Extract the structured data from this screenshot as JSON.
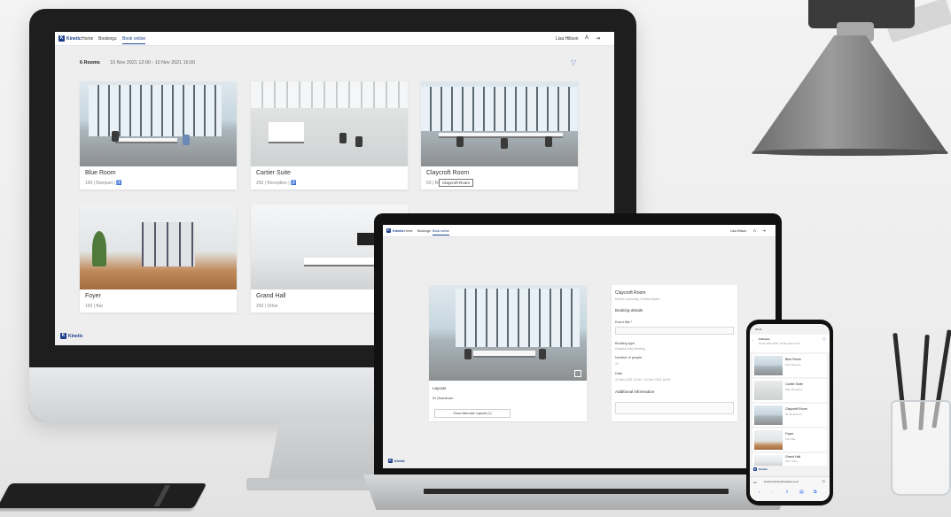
{
  "imac_app": {
    "brand": "Kinetic",
    "nav": {
      "home": "Home",
      "bookings": "Bookings",
      "book_online": "Book online"
    },
    "user": {
      "name": "Lisa Hillson"
    },
    "summary": {
      "count": "6 Rooms",
      "range": "10 Nov 2021 12:00 - 10 Nov 2021 16:00"
    },
    "rooms": [
      {
        "name": "Blue Room",
        "meta": "100 | Banquet | ♿"
      },
      {
        "name": "Cartier Suite",
        "meta": "250 | Reception | ♿"
      },
      {
        "name": "Claycroft Room",
        "meta": "50 | Boardroom"
      },
      {
        "name": "Foyer",
        "meta": "150 | Bar"
      },
      {
        "name": "Grand Hall",
        "meta": "250 | Other"
      }
    ],
    "tooltip": "Claycroft Room",
    "footer_brand": "Kinetic"
  },
  "laptop_app": {
    "brand": "Kinetic",
    "nav": {
      "home": "Home",
      "bookings": "Bookings",
      "book_online": "Book online"
    },
    "user": {
      "name": "Lisa Hillson"
    },
    "layouts": {
      "heading": "Layouts",
      "value": "50 | Boardroom",
      "button": "Show Alternate Layouts (1)"
    },
    "room": {
      "title": "Claycroft Room",
      "subtitle": "Kinetic University, Central Wales"
    },
    "booking": {
      "heading": "Booking details",
      "event_title_label": "Event title *",
      "booking_type_label": "Booking type",
      "booking_type_value": "Campus Day Meeting",
      "people_label": "Number of people",
      "people_value": "10",
      "date_label": "Date",
      "date_value": "10 Nov 2021 12:00 - 10 Nov 2021 16:00",
      "additional": "Additional information"
    },
    "footer_brand": "Kinetic"
  },
  "phone_app": {
    "time": "09:41",
    "header": {
      "count": "6 Rooms",
      "range": "10 Nov 2021 09:00 - 10 Nov 2021 12:00"
    },
    "rooms": [
      {
        "name": "Blue Room",
        "meta": "100 | Banquet"
      },
      {
        "name": "Cartier Suite",
        "meta": "250 | Reception"
      },
      {
        "name": "Claycroft Room",
        "meta": "50 | Boardroom"
      },
      {
        "name": "Foyer",
        "meta": "150 | Bar"
      },
      {
        "name": "Grand Hall",
        "meta": "250 | Other"
      }
    ],
    "footer_brand": "Kinetic",
    "url": "kineticuniversity.kxbookings.co.uk"
  },
  "colors": {
    "brand_blue": "#1c3f8c",
    "filter": "#7c8fd4"
  }
}
